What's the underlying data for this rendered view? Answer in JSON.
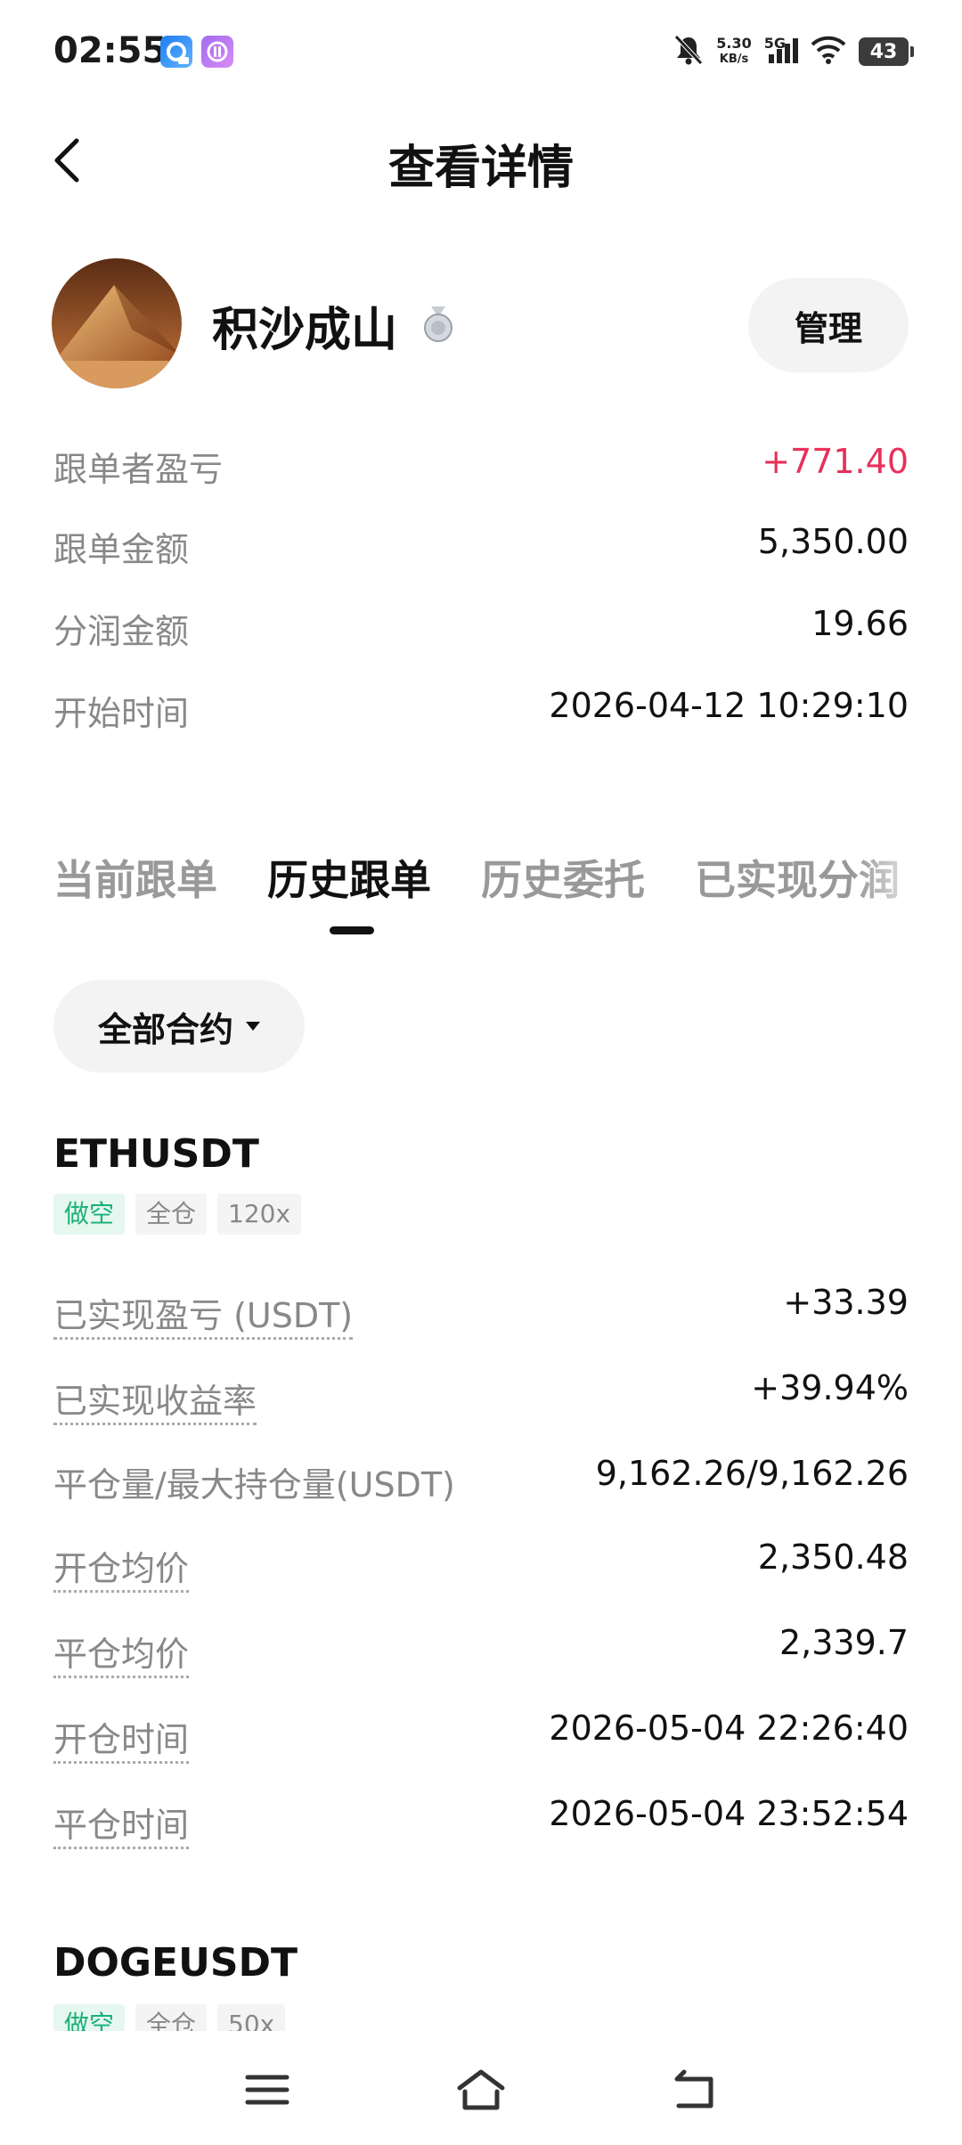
{
  "status_bar": {
    "time": "02:55",
    "net_speed_value": "5.30",
    "net_speed_unit": "KB/s",
    "network": "5G",
    "battery": "43",
    "icons": [
      "app-icon-blue",
      "app-icon-purple",
      "mute-bell-icon",
      "signal-icon",
      "wifi-icon",
      "battery-icon"
    ]
  },
  "header": {
    "title": "查看详情",
    "back_icon": "chevron-left-icon"
  },
  "trader": {
    "name": "积沙成山",
    "badge_icon": "silver-medal-icon",
    "manage_label": "管理"
  },
  "stats": [
    {
      "label": "跟单者盈亏",
      "value": "+771.40"
    },
    {
      "label": "跟单金额",
      "value": "5,350.00"
    },
    {
      "label": "分润金额",
      "value": "19.66"
    },
    {
      "label": "开始时间",
      "value": "2026-04-12 10:29:10"
    }
  ],
  "tabs": [
    {
      "label": "当前跟单",
      "active": false
    },
    {
      "label": "历史跟单",
      "active": true
    },
    {
      "label": "历史委托",
      "active": false
    },
    {
      "label": "已实现分润",
      "active": false
    }
  ],
  "filter": {
    "label": "全部合约"
  },
  "positions": [
    {
      "symbol": "ETHUSDT",
      "tags": [
        "做空",
        "全仓",
        "120x"
      ],
      "rows": [
        {
          "label": "已实现盈亏 (USDT)",
          "value": "+33.39"
        },
        {
          "label": "已实现收益率",
          "value": "+39.94%"
        },
        {
          "label": "平仓量/最大持仓量(USDT)",
          "value": "9,162.26/9,162.26"
        },
        {
          "label": "开仓均价",
          "value": "2,350.48"
        },
        {
          "label": "平仓均价",
          "value": "2,339.7"
        },
        {
          "label": "开仓时间",
          "value": "2026-05-04 22:26:40"
        },
        {
          "label": "平仓时间",
          "value": "2026-05-04 23:52:54"
        }
      ]
    },
    {
      "symbol": "DOGEUSDT",
      "tags": [
        "做空",
        "全仓",
        "50x"
      ]
    }
  ],
  "nav_bar": {
    "icons": [
      "menu-icon",
      "home-icon",
      "back-icon"
    ]
  },
  "colors": {
    "profit_red": "#e8305a",
    "short_green": "#19b07a",
    "muted_gray": "#888888"
  }
}
